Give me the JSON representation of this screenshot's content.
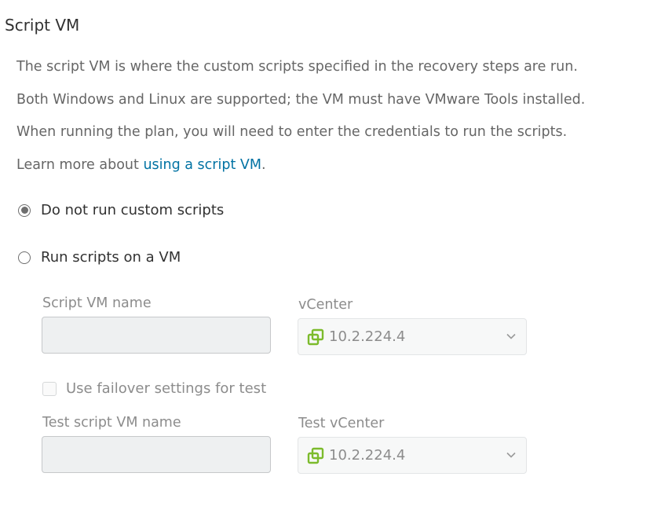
{
  "section": {
    "title": "Script VM",
    "description": [
      "The script VM is where the custom scripts specified in the recovery steps are run.",
      "Both Windows and Linux are supported; the VM must have VMware Tools installed.",
      "When running the plan, you will need to enter the credentials to run the scripts."
    ],
    "learn_more_prefix": "Learn more about ",
    "learn_more_link": "using a script VM",
    "learn_more_suffix": "."
  },
  "options": {
    "no_scripts_label": "Do not run custom scripts",
    "no_scripts_selected": true,
    "run_scripts_label": "Run scripts on a VM",
    "run_scripts_selected": false
  },
  "form": {
    "script_vm_name_label": "Script VM name",
    "script_vm_name_value": "",
    "vcenter_label": "vCenter",
    "vcenter_value": "10.2.224.4",
    "use_failover_label": "Use failover settings for test",
    "use_failover_checked": false,
    "test_script_vm_name_label": "Test script VM name",
    "test_script_vm_name_value": "",
    "test_vcenter_label": "Test vCenter",
    "test_vcenter_value": "10.2.224.4"
  },
  "icons": {
    "vcenter": "vcenter-icon",
    "chevron": "chevron-down-icon"
  },
  "colors": {
    "link": "#0072a3",
    "vcenter_icon": "#7cbb2c"
  }
}
